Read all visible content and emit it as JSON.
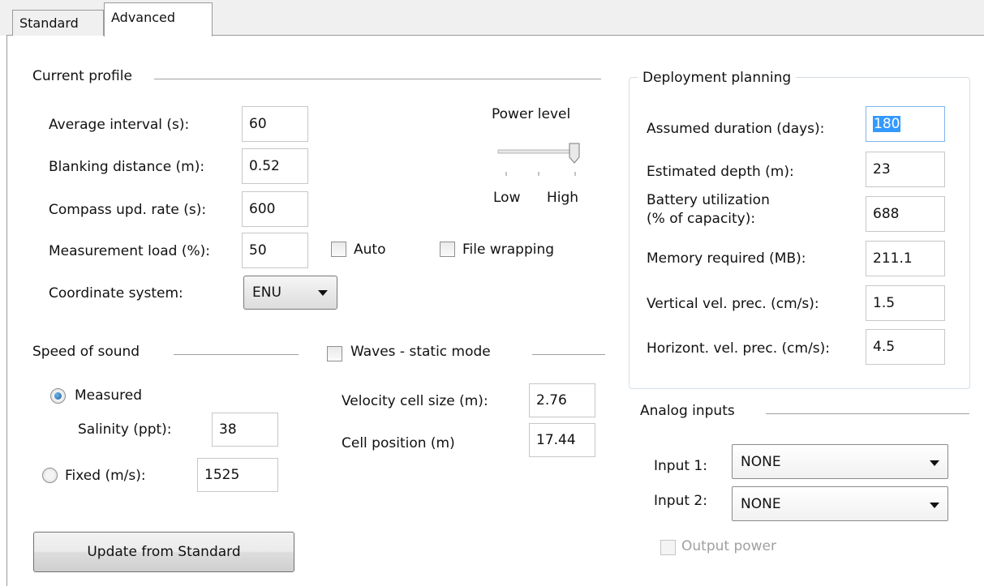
{
  "tabs": {
    "standard": "Standard",
    "advanced": "Advanced"
  },
  "current_profile": {
    "title": "Current profile",
    "average_interval_label": "Average interval (s):",
    "average_interval_value": "60",
    "blanking_distance_label": "Blanking distance (m):",
    "blanking_distance_value": "0.52",
    "compass_rate_label": "Compass upd. rate (s):",
    "compass_rate_value": "600",
    "measurement_load_label": "Measurement load (%):",
    "measurement_load_value": "50",
    "auto_label": "Auto",
    "file_wrapping_label": "File wrapping",
    "coordinate_system_label": "Coordinate system:",
    "coordinate_system_value": "ENU",
    "power_level_label": "Power level",
    "power_low": "Low",
    "power_high": "High",
    "power_level_fraction": 1.0
  },
  "speed_of_sound": {
    "title": "Speed of sound",
    "measured_label": "Measured",
    "salinity_label": "Salinity (ppt):",
    "salinity_value": "38",
    "fixed_label": "Fixed (m/s):",
    "fixed_value": "1525",
    "selected": "Measured"
  },
  "waves": {
    "title": "Waves - static mode",
    "cell_size_label": "Velocity cell size (m):",
    "cell_size_value": "2.76",
    "cell_position_label": "Cell position (m)",
    "cell_position_value": "17.44"
  },
  "update_button": "Update from Standard",
  "deployment": {
    "title": "Deployment planning",
    "duration_label": "Assumed duration (days):",
    "duration_value": "180",
    "depth_label": "Estimated depth (m):",
    "depth_value": "23",
    "battery_label_1": "Battery utilization",
    "battery_label_2": "(% of capacity):",
    "battery_value": "688",
    "memory_label": "Memory required (MB):",
    "memory_value": "211.1",
    "vertical_label": "Vertical vel. prec. (cm/s):",
    "vertical_value": "1.5",
    "horizontal_label": "Horizont. vel. prec. (cm/s):",
    "horizontal_value": "4.5"
  },
  "analog": {
    "title": "Analog inputs",
    "input1_label": "Input 1:",
    "input1_value": "NONE",
    "input2_label": "Input 2:",
    "input2_value": "NONE",
    "output_power_label": "Output power"
  }
}
